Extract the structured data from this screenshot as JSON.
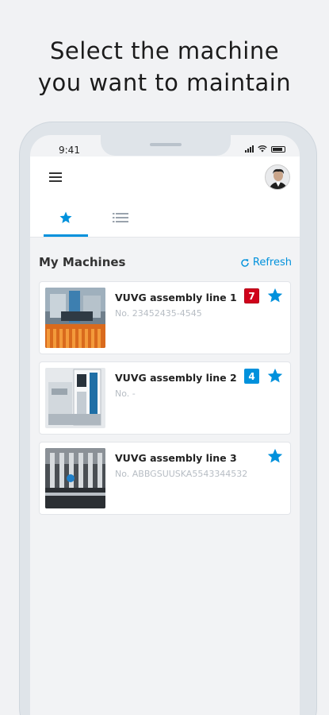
{
  "headline": {
    "line1": "Select the machine",
    "line2": "you want to maintain"
  },
  "statusbar": {
    "time": "9:41"
  },
  "tabs": [
    {
      "icon": "star-icon",
      "active": true
    },
    {
      "icon": "list-icon",
      "active": false
    }
  ],
  "section": {
    "title": "My Machines",
    "refresh_label": "Refresh"
  },
  "machines": [
    {
      "name": "VUVG assembly line 1",
      "number": "No. 23452435-4545",
      "badge": "7",
      "badge_color": "#d0021b",
      "favorite": true
    },
    {
      "name": "VUVG assembly line 2",
      "number": "No. -",
      "badge": "4",
      "badge_color": "#0091dc",
      "favorite": true
    },
    {
      "name": "VUVG assembly line 3",
      "number": "No. ABBGSUUSKA5543344532",
      "badge": "",
      "favorite": true
    }
  ],
  "colors": {
    "accent": "#0091dc",
    "alert": "#d0021b"
  }
}
